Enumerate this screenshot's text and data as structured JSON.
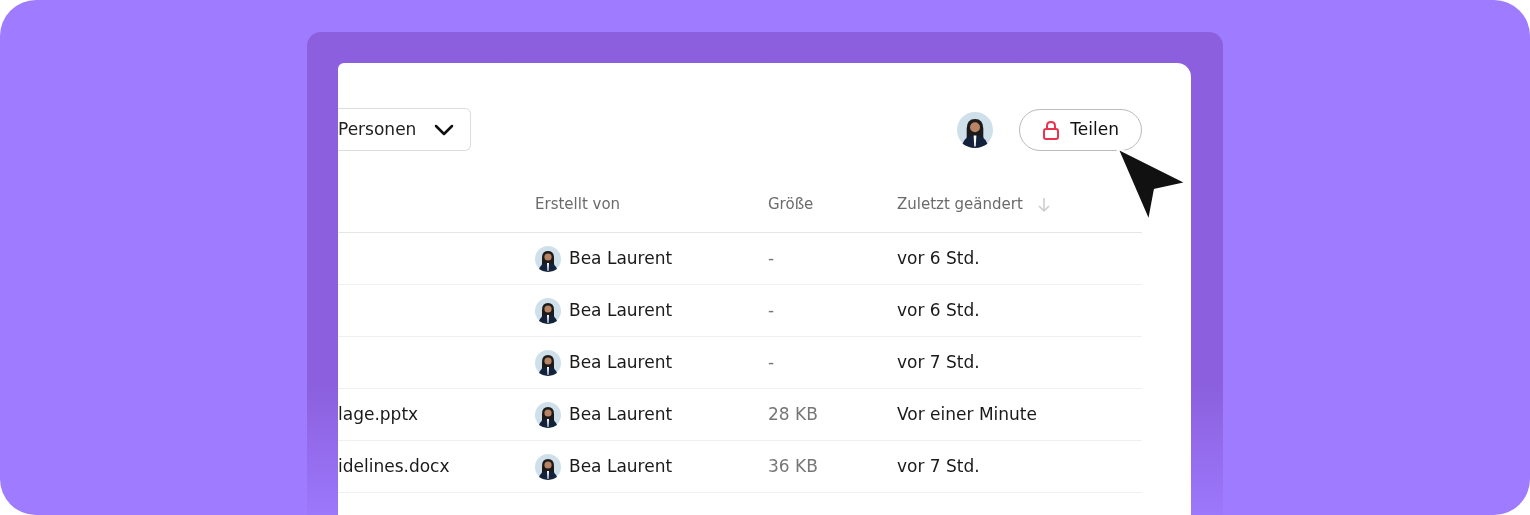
{
  "toolbar": {
    "filter": {
      "label": "Personen"
    },
    "share_button": {
      "label": "Teilen"
    }
  },
  "table": {
    "columns": [
      {
        "label": "Erstellt von",
        "sorted": false
      },
      {
        "label": "Größe",
        "sorted": false
      },
      {
        "label": "Zuletzt geändert",
        "sorted": true
      }
    ],
    "rows": [
      {
        "name": "",
        "creator": "Bea Laurent",
        "size": "-",
        "modified": "vor 6 Std."
      },
      {
        "name": "",
        "creator": "Bea Laurent",
        "size": "-",
        "modified": "vor 6 Std."
      },
      {
        "name": "",
        "creator": "Bea Laurent",
        "size": "-",
        "modified": "vor 7 Std."
      },
      {
        "name": "lage.pptx",
        "creator": "Bea Laurent",
        "size": "28 KB",
        "modified": "Vor einer Minute"
      },
      {
        "name": "idelines.docx",
        "creator": "Bea Laurent",
        "size": "36 KB",
        "modified": "vor 7 Std."
      }
    ]
  }
}
